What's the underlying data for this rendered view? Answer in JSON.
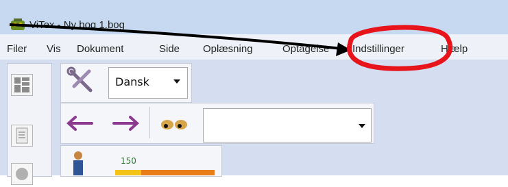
{
  "window": {
    "title": "ViTex - Ny bog 1.bog"
  },
  "menu": {
    "items": [
      "Filer",
      "Vis",
      "Dokument",
      "Side",
      "Oplæsning",
      "Optagelse",
      "Indstillinger",
      "Hjælp"
    ],
    "highlighted": "Indstillinger"
  },
  "toolbar": {
    "language": "Dansk"
  },
  "status": {
    "value": "150"
  },
  "colors": {
    "annotation_circle": "#e8141c",
    "arrow": "#000000",
    "bar_fill": "#e97d17",
    "bar_fill_left": "#f3c317",
    "value_text": "#2e7d32"
  },
  "icons": [
    "app-icon",
    "layout-grid-icon",
    "document-icon",
    "tools-icon",
    "chevron-down-icon",
    "arrow-left-icon",
    "arrow-right-icon",
    "eyes-icon",
    "person-icon"
  ]
}
